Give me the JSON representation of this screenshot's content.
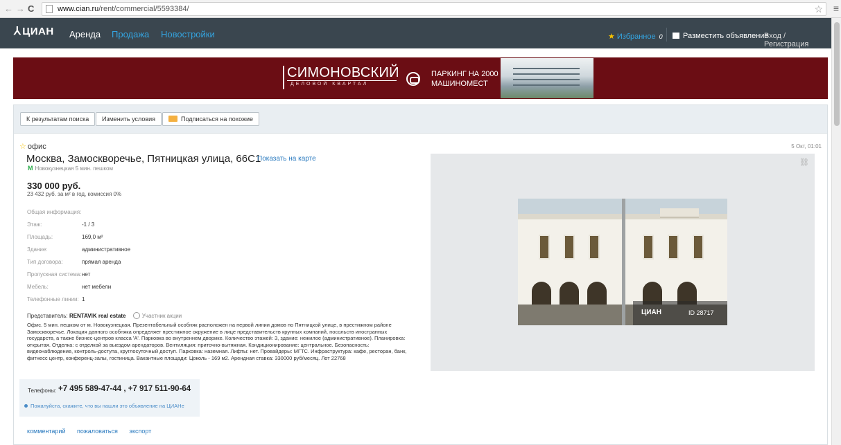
{
  "browser": {
    "url_domain": "www.cian.ru",
    "url_path": "/rent/commercial/5593384/"
  },
  "header": {
    "logo": "ЦИАН",
    "nav": [
      "Аренда",
      "Продажа",
      "Новостройки"
    ],
    "favorites_label": "Избранное",
    "favorites_count": "0",
    "post_ad": "Разместить объявление",
    "login": "Вход / Регистрация"
  },
  "banner": {
    "brand": "СИМОНОВСКИЙ",
    "brand_sub": "ДЕЛОВОЙ КВАРТАЛ",
    "parking_line1": "ПАРКИНГ НА 2000",
    "parking_line2": "МАШИНОМЕСТ"
  },
  "toolbar": {
    "back_to_results": "К результатам поиска",
    "change_conditions": "Изменить условия",
    "subscribe_similar": "Подписаться на похожие"
  },
  "listing": {
    "type": "офис",
    "date": "5 Окт, 01:01",
    "address": "Москва, Замоскворечье, Пятницкая улица, 66С1",
    "map_link": "Показать на карте",
    "metro": "Новокузнецкая 5 мин. пешком",
    "price": "330 000 руб.",
    "price_sub": "23 432 руб. за м² в год, комиссия 0%",
    "info_title": "Общая информация:",
    "info": [
      {
        "key": "Этаж:",
        "value": "-1 / 3"
      },
      {
        "key": "Площадь:",
        "value": "169,0 м²"
      },
      {
        "key": "Здание:",
        "value": "административное"
      },
      {
        "key": "Тип договора:",
        "value": "прямая аренда"
      },
      {
        "key": "Пропускная система:",
        "value": "нет"
      },
      {
        "key": "Мебель:",
        "value": "нет мебели"
      },
      {
        "key": "Телефонные линии:",
        "value": "1"
      }
    ],
    "rep_label": "Представитель:",
    "rep_name": "RENTAVIK real estate",
    "rep_badge": "Участник акции",
    "description": "Офис. 5 мин. пешком от м. Новокузнецкая. Презентабельный особняк расположен на первой линии домов по Пятницкой улице, в престижном районе Замоскворечье. Локация данного особняка определяет престижное окружение в лице представительств крупных компаний, посольств иностранных государств, а также бизнес-центров класса 'А'. Парковка во внутреннем дворике. Количество этажей: 3, здание: нежилое (административное). Планировка: открытая. Отделка: с отделкой за выездом арендаторов. Вентиляция: приточно-вытяжная. Кондиционирование: центральное. Безопасность: видеонаблюдение, контроль-доступа, круглосуточный доступ. Парковка: наземная. Лифты: нет. Провайдеры: МГТС. Инфраструктура: кафе, ресторан, банк, фитнесс центр, конференц-залы, гостиница. Вакантные площади: Цоколь - 169 м2. Арендная ставка: 330000 руб/месяц. Лот 22768",
    "phones_label": "Телефоны:",
    "phones": "+7 495 589-47-44 , +7 917 511-90-64",
    "phone_note": "Пожалуйста, скажите, что вы нашли это объявление на ЦИАНе",
    "actions": [
      "комментарий",
      "пожаловаться",
      "экспорт"
    ],
    "photo_watermark_logo": "ЦИАН",
    "photo_watermark_id": "ID 28717"
  }
}
